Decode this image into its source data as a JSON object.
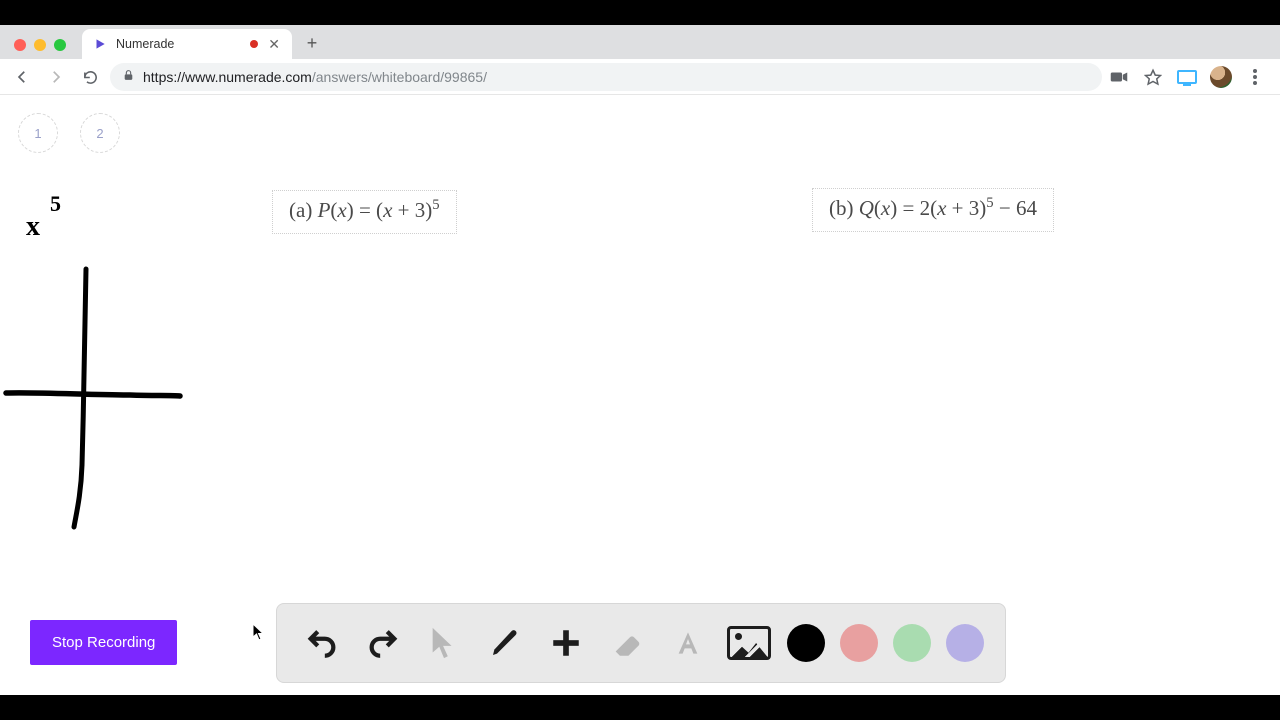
{
  "browser": {
    "tab_title": "Numerade",
    "url_display_prefix": "https://www.numerade.com",
    "url_display_suffix": "/answers/whiteboard/99865/"
  },
  "pagenav": {
    "p1": "1",
    "p2": "2"
  },
  "equations": {
    "a_label": "(a) ",
    "a_func": "P",
    "a_arg": "x",
    "a_eq": " = (",
    "a_inner": "x",
    "a_plus": " + 3)",
    "a_exp": "5",
    "b_label": "(b) ",
    "b_func": "Q",
    "b_arg": "x",
    "b_eq": " = 2(",
    "b_inner": "x",
    "b_plus": " + 3)",
    "b_exp": "5",
    "b_tail": " − 64"
  },
  "handwriting": {
    "base": "x",
    "exp": "5"
  },
  "controls": {
    "stop_label": "Stop Recording"
  },
  "toolbar": {
    "undo": "undo",
    "redo": "redo",
    "pointer": "pointer",
    "pen": "pen",
    "plus": "plus",
    "eraser": "eraser",
    "text": "text",
    "image": "image"
  },
  "colors": {
    "black": "#000000",
    "red": "#e8a0a0",
    "green": "#a9dcb0",
    "purple": "#b6b0e6"
  }
}
